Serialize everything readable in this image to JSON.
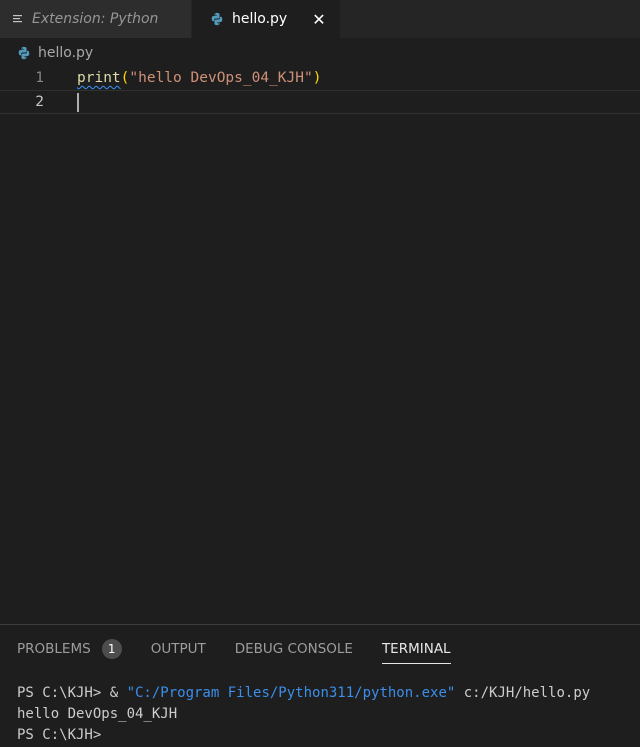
{
  "tabs": [
    {
      "label": "Extension: Python",
      "active": false,
      "icon": "list-icon"
    },
    {
      "label": "hello.py",
      "active": true,
      "icon": "python-icon",
      "close": "✕"
    }
  ],
  "breadcrumb": {
    "file": "hello.py",
    "icon": "python-icon"
  },
  "editor": {
    "lines": [
      {
        "number": "1",
        "fn": "print",
        "open": "(",
        "string": "\"hello DevOps_04_KJH\"",
        "close": ")"
      },
      {
        "number": "2"
      }
    ]
  },
  "panel": {
    "tabs": [
      {
        "label": "PROBLEMS",
        "badge": "1"
      },
      {
        "label": "OUTPUT"
      },
      {
        "label": "DEBUG CONSOLE"
      },
      {
        "label": "TERMINAL",
        "active": true
      }
    ],
    "terminal": {
      "line1_prompt": "PS C:\\KJH> & ",
      "line1_exe": "\"C:/Program Files/Python311/python.exe\"",
      "line1_arg": " c:/KJH/hello.py",
      "line2": "hello DevOps_04_KJH",
      "line3": "PS C:\\KJH> "
    }
  },
  "colors": {
    "editor_bg": "#1e1e1e",
    "tab_bar_bg": "#252526",
    "function": "#dcdcaa",
    "string": "#ce9178",
    "bracket": "#ffd700",
    "terminal_path": "#3b8eea"
  }
}
